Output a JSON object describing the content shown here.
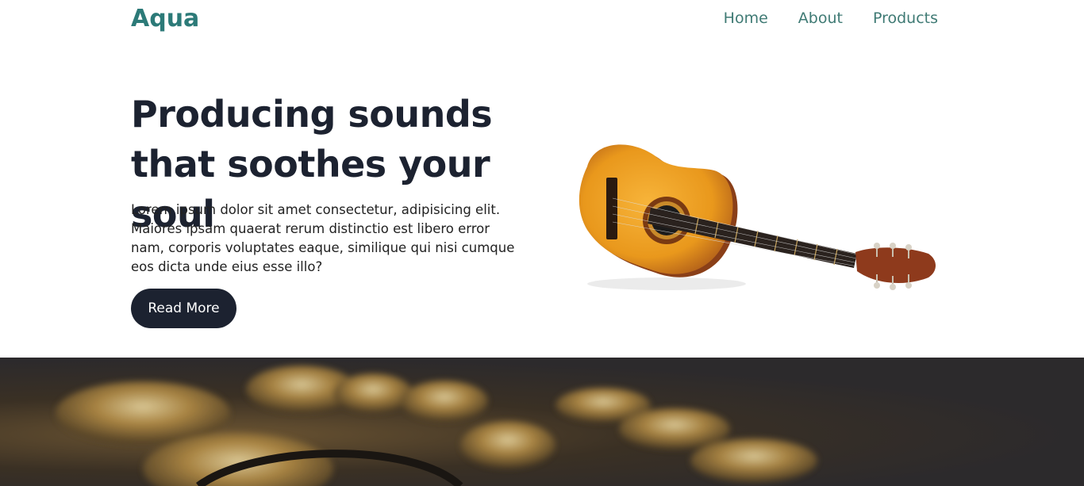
{
  "colors": {
    "brand": "#2c7a78",
    "nav_link": "#3f7a74",
    "heading": "#1c2230",
    "button_bg": "#1c2230",
    "button_text": "#ffffff"
  },
  "header": {
    "logo": "Aqua",
    "nav": [
      "Home",
      "About",
      "Products"
    ]
  },
  "hero": {
    "title": "Producing sounds that soothes your soul",
    "body": "Lorem ipsum dolor sit amet consectetur, adipisicing elit. Maiores ipsam quaerat rerum distinctio est libero error nam, corporis voluptates eaque, similique qui nisi cumque eos dicta unde eius esse illo?",
    "cta_label": "Read More",
    "image_icon": "acoustic-guitar-image"
  },
  "banner": {
    "image_icon": "saxophone-background-image"
  }
}
